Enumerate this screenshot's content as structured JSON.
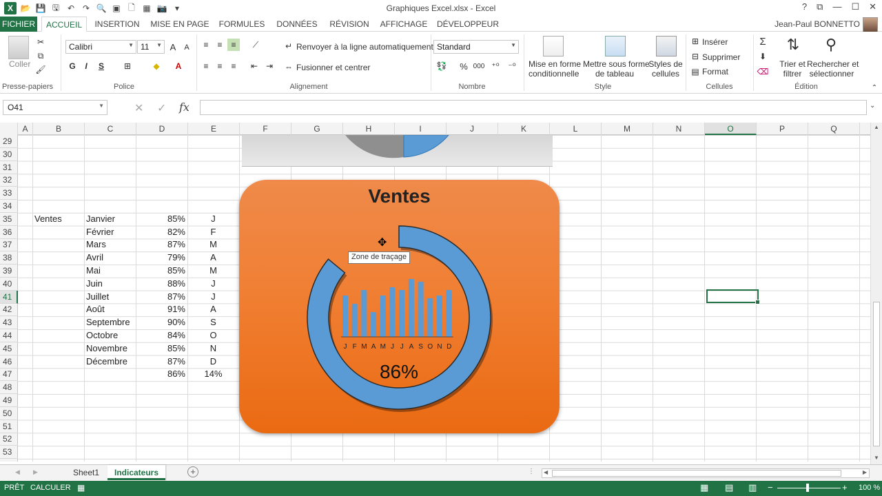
{
  "window": {
    "title": "Graphiques Excel.xlsx - Excel",
    "help": "?",
    "restore": "⧉",
    "minimize": "—",
    "maximize": "☐",
    "close": "✕"
  },
  "tabs": [
    "FICHIER",
    "ACCUEIL",
    "INSERTION",
    "MISE EN PAGE",
    "FORMULES",
    "DONNÉES",
    "RÉVISION",
    "AFFICHAGE",
    "DÉVELOPPEUR"
  ],
  "user": "Jean-Paul BONNETTO",
  "ribbon": {
    "clipboard": {
      "paste": "Coller",
      "label": "Presse-papiers"
    },
    "font": {
      "name": "Calibri",
      "size": "11",
      "bold": "G",
      "italic": "I",
      "underline": "S",
      "label": "Police",
      "grow": "A",
      "shrink": "A"
    },
    "alignment": {
      "wrap": "Renvoyer à la ligne automatiquement",
      "merge": "Fusionner et centrer",
      "label": "Alignement"
    },
    "number": {
      "format": "Standard",
      "percent": "%",
      "thousands": "000",
      "label": "Nombre"
    },
    "style": {
      "conditional_1": "Mise en forme",
      "conditional_2": "conditionnelle",
      "table_1": "Mettre sous forme",
      "table_2": "de tableau",
      "cells_1": "Styles de",
      "cells_2": "cellules",
      "label": "Style"
    },
    "cells": {
      "insert": "Insérer",
      "delete": "Supprimer",
      "format": "Format",
      "label": "Cellules"
    },
    "editing": {
      "sort_1": "Trier et",
      "sort_2": "filtrer",
      "find_1": "Rechercher et",
      "find_2": "sélectionner",
      "label": "Édition"
    }
  },
  "formula_bar": {
    "name_box": "O41",
    "fx": "fx",
    "value": ""
  },
  "columns": [
    "A",
    "B",
    "C",
    "D",
    "E",
    "F",
    "G",
    "H",
    "I",
    "J",
    "K",
    "L",
    "M",
    "N",
    "O",
    "P",
    "Q"
  ],
  "rows": [
    "29",
    "30",
    "31",
    "32",
    "33",
    "34",
    "35",
    "36",
    "37",
    "38",
    "39",
    "40",
    "41",
    "42",
    "43",
    "44",
    "45",
    "46",
    "47",
    "48",
    "49",
    "50",
    "51",
    "52",
    "53"
  ],
  "table": {
    "label": "Ventes",
    "months": [
      {
        "name": "Janvier",
        "value": "85%",
        "initial": "J"
      },
      {
        "name": "Février",
        "value": "82%",
        "initial": "F"
      },
      {
        "name": "Mars",
        "value": "87%",
        "initial": "M"
      },
      {
        "name": "Avril",
        "value": "79%",
        "initial": "A"
      },
      {
        "name": "Mai",
        "value": "85%",
        "initial": "M"
      },
      {
        "name": "Juin",
        "value": "88%",
        "initial": "J"
      },
      {
        "name": "Juillet",
        "value": "87%",
        "initial": "J"
      },
      {
        "name": "Août",
        "value": "91%",
        "initial": "A"
      },
      {
        "name": "Septembre",
        "value": "90%",
        "initial": "S"
      },
      {
        "name": "Octobre",
        "value": "84%",
        "initial": "O"
      },
      {
        "name": "Novembre",
        "value": "85%",
        "initial": "N"
      },
      {
        "name": "Décembre",
        "value": "87%",
        "initial": "D"
      }
    ],
    "total": "86%",
    "remainder": "14%"
  },
  "chart_data": {
    "type": "bar",
    "title": "Ventes",
    "categories": [
      "J",
      "F",
      "M",
      "A",
      "M",
      "J",
      "J",
      "A",
      "S",
      "O",
      "N",
      "D"
    ],
    "values": [
      85,
      82,
      87,
      79,
      85,
      88,
      87,
      91,
      90,
      84,
      85,
      87
    ],
    "ylim": [
      70,
      95
    ],
    "donut": {
      "value": 86,
      "remainder": 14,
      "label": "86%"
    },
    "colors": {
      "ring": "#5b9bd5",
      "bars": "#5b9bd5",
      "background": "#ef7f2f"
    }
  },
  "tooltip": "Zone de traçage",
  "sheets": [
    "Sheet1",
    "Indicateurs"
  ],
  "status": {
    "ready": "PRÊT",
    "calc": "CALCULER",
    "zoom": "100 %"
  }
}
